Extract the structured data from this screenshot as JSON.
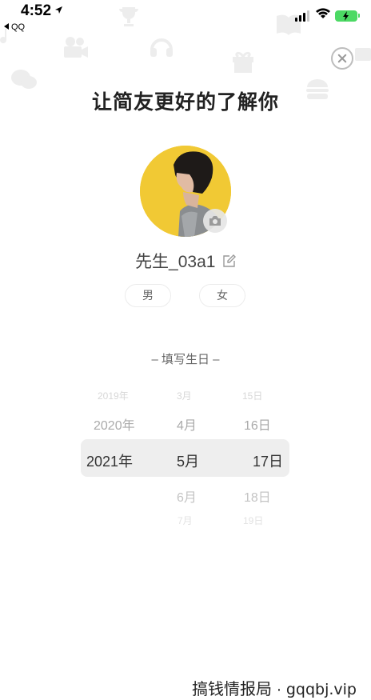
{
  "status_bar": {
    "time": "4:52",
    "back_app": "QQ"
  },
  "title": "让简友更好的了解你",
  "profile": {
    "nickname": "先生_03a1"
  },
  "gender": {
    "male": "男",
    "female": "女"
  },
  "birthday_label": "– 填写生日 –",
  "picker": {
    "years": [
      "2019年",
      "2020年",
      "2021年"
    ],
    "months": [
      "3月",
      "4月",
      "5月",
      "6月",
      "7月"
    ],
    "days": [
      "15日",
      "16日",
      "17日",
      "18日",
      "19日"
    ],
    "selected": {
      "year": "2021年",
      "month": "5月",
      "day": "17日"
    }
  },
  "watermark": {
    "text": "搞钱情报局 · ",
    "url": "gqqbj.vip"
  },
  "colors": {
    "accent_battery": "#4cd964",
    "avatar_background": "#f1c934"
  }
}
